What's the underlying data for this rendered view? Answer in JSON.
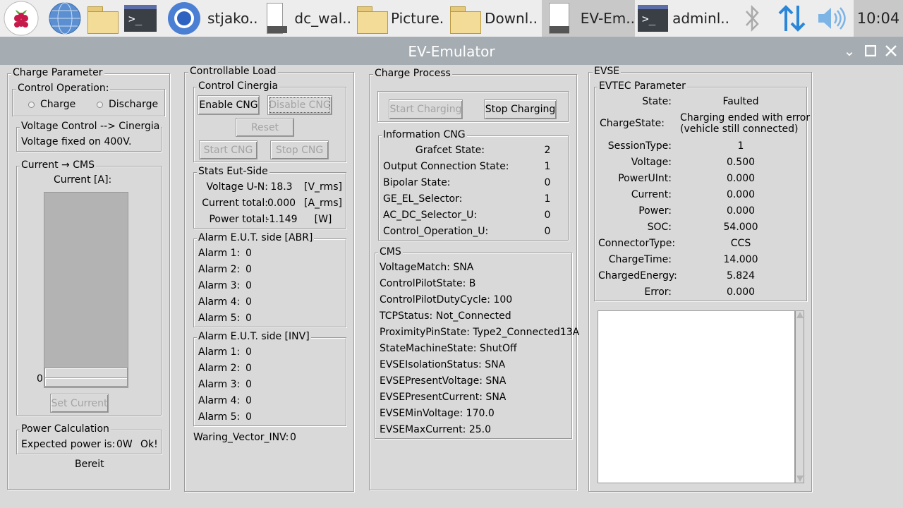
{
  "taskbar": {
    "items": [
      {
        "label": "stjako.."
      },
      {
        "label": "dc_wal.."
      },
      {
        "label": "Picture."
      },
      {
        "label": "Downl.."
      },
      {
        "label": "EV-Em.."
      },
      {
        "label": "adminl.."
      }
    ],
    "clock": "10:04",
    "icons": [
      "raspberry-icon",
      "globe-icon",
      "folder-icon",
      "terminal-icon",
      "chromium-icon",
      "bluetooth-icon",
      "network-icon",
      "volume-icon"
    ]
  },
  "window": {
    "title": "EV-Emulator"
  },
  "charge_parameter": {
    "legend": "Charge Parameter",
    "control_operation": {
      "legend": "Control Operation:",
      "charge": "Charge",
      "discharge": "Discharge"
    },
    "voltage_control": {
      "legend": "Voltage Control --> Cinergia",
      "text": "Voltage fixed on 400V."
    },
    "current": {
      "legend": "Current → CMS",
      "label": "Current [A]:",
      "scale_zero": "0",
      "set_button": "Set Current"
    },
    "power": {
      "legend": "Power Calculation",
      "label": "Expected power is:",
      "value": "0W",
      "status": "Ok!"
    },
    "status": "Bereit"
  },
  "controllable_load": {
    "legend": "Controllable Load",
    "control": {
      "legend": "Control Cinergia",
      "enable": "Enable CNG",
      "disable": "Disable CNG",
      "reset": "Reset",
      "start": "Start CNG",
      "stop": "Stop CNG"
    },
    "stats": {
      "legend": "Stats Eut-Side",
      "rows": [
        {
          "label": "Voltage U-N:",
          "value": "18.3",
          "unit": "[V_rms]"
        },
        {
          "label": "Current total:",
          "value": "0.000",
          "unit": "[A_rms]"
        },
        {
          "label": "Power total:",
          "value": "-1.149",
          "unit": "[W]"
        }
      ]
    },
    "alarm_abr": {
      "legend": "Alarm E.U.T. side [ABR]",
      "rows": [
        {
          "label": "Alarm 1:",
          "value": "0"
        },
        {
          "label": "Alarm 2:",
          "value": "0"
        },
        {
          "label": "Alarm 3:",
          "value": "0"
        },
        {
          "label": "Alarm 4:",
          "value": "0"
        },
        {
          "label": "Alarm 5:",
          "value": "0"
        }
      ]
    },
    "alarm_inv": {
      "legend": "Alarm E.U.T. side [INV]",
      "rows": [
        {
          "label": "Alarm 1:",
          "value": "0"
        },
        {
          "label": "Alarm 2:",
          "value": "0"
        },
        {
          "label": "Alarm 3:",
          "value": "0"
        },
        {
          "label": "Alarm 4:",
          "value": "0"
        },
        {
          "label": "Alarm 5:",
          "value": "0"
        }
      ]
    },
    "warning": {
      "label": "Waring_Vector_INV:",
      "value": "0"
    }
  },
  "charge_process": {
    "legend": "Charge Process",
    "start": "Start Charging",
    "stop": "Stop Charging",
    "info": {
      "legend": "Information CNG",
      "rows": [
        {
          "label": "Grafcet State:",
          "value": "2"
        },
        {
          "label": "Output Connection State:",
          "value": "1"
        },
        {
          "label": "Bipolar State:",
          "value": "0"
        },
        {
          "label": "GE_EL_Selector:",
          "value": "1"
        },
        {
          "label": "AC_DC_Selector_U:",
          "value": "0"
        },
        {
          "label": "Control_Operation_U:",
          "value": "0"
        }
      ]
    },
    "cms": {
      "legend": "CMS",
      "lines": [
        "VoltageMatch: SNA",
        "ControlPilotState: B",
        "ControlPilotDutyCycle: 100",
        "TCPStatus: Not_Connected",
        "ProximityPinState: Type2_Connected13A",
        "StateMachineState: ShutOff",
        "EVSEIsolationStatus: SNA",
        "EVSEPresentVoltage: SNA",
        "EVSEPresentCurrent: SNA",
        "EVSEMinVoltage: 170.0",
        "EVSEMaxCurrent: 25.0"
      ]
    }
  },
  "evse": {
    "legend": "EVSE",
    "evtec": {
      "legend": "EVTEC Parameter",
      "rows": [
        {
          "label": "State:",
          "value": "Faulted"
        },
        {
          "label": "ChargeState:",
          "value": "Charging ended with error",
          "value2": "(vehicle still connected)"
        },
        {
          "label": "SessionType:",
          "value": "1"
        },
        {
          "label": "Voltage:",
          "value": "0.500"
        },
        {
          "label": "PowerUInt:",
          "value": "0.000"
        },
        {
          "label": "Current:",
          "value": "0.000"
        },
        {
          "label": "Power:",
          "value": "0.000"
        },
        {
          "label": "SOC:",
          "value": "54.000"
        },
        {
          "label": "ConnectorType:",
          "value": "CCS"
        },
        {
          "label": "ChargeTime:",
          "value": "14.000"
        },
        {
          "label": "ChargedEnergy:",
          "value": "5.824"
        },
        {
          "label": "Error:",
          "value": "0.000"
        }
      ]
    }
  }
}
